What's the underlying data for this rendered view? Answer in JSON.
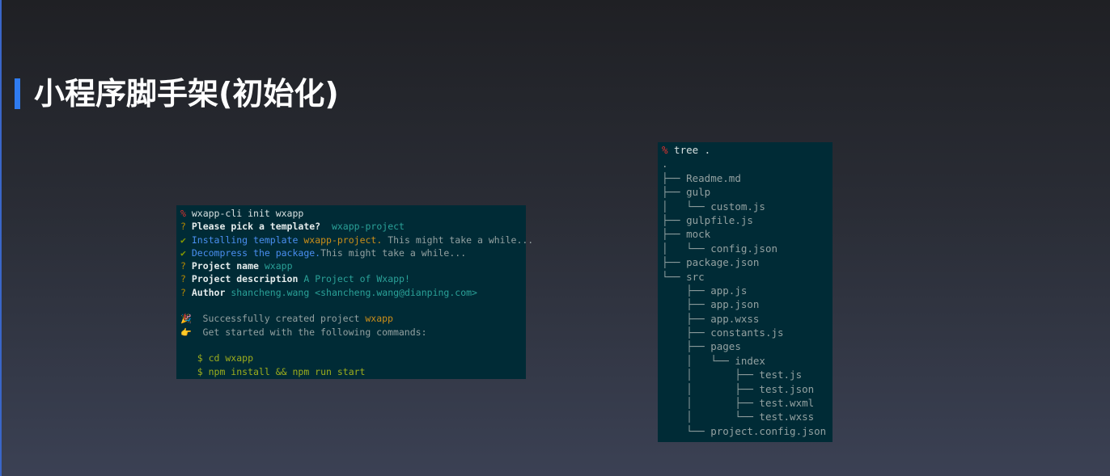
{
  "slide": {
    "title": "小程序脚手架(初始化)"
  },
  "left_terminal": {
    "prompt": "%",
    "command": " wxapp-cli init wxapp",
    "q1_mark": "?",
    "q1_label": " Please pick a template?",
    "q1_value": "  wxapp-project",
    "install_mark": "✔",
    "install_text": " Installing template",
    "install_name": " wxapp-project.",
    "install_tail": " This might take a while...",
    "decompress_mark": "✔",
    "decompress_text": " Decompress the package.",
    "decompress_tail": "This might take a while...",
    "q2_mark": "?",
    "q2_label": " Project name",
    "q2_value": " wxapp",
    "q3_mark": "?",
    "q3_label": " Project description",
    "q3_value": " A Project of Wxapp!",
    "q4_mark": "?",
    "q4_label": " Author",
    "q4_value": " shancheng.wang <shancheng.wang@dianping.com>",
    "success_icon": "🎉",
    "success_text": "  Successfully created project",
    "success_name": " wxapp",
    "start_icon": "👉",
    "start_text": "  Get started with the following commands:",
    "cmd1": "   $ cd wxapp",
    "cmd2": "   $ npm install && npm run start",
    "colors": {
      "background": "#002b36",
      "prompt": "#dc322f",
      "question": "#b58900",
      "check": "#859900",
      "value": "#2aa198",
      "highlight": "#cb8f19",
      "install": "#4a8ff0"
    }
  },
  "right_terminal": {
    "prompt": "%",
    "command": " tree .",
    "lines": [
      {
        "branch": "",
        "name": "."
      },
      {
        "branch": "├── ",
        "name": "Readme.md"
      },
      {
        "branch": "├── ",
        "name": "gulp"
      },
      {
        "branch": "│   └── ",
        "name": "custom.js"
      },
      {
        "branch": "├── ",
        "name": "gulpfile.js"
      },
      {
        "branch": "├── ",
        "name": "mock"
      },
      {
        "branch": "│   └── ",
        "name": "config.json"
      },
      {
        "branch": "├── ",
        "name": "package.json"
      },
      {
        "branch": "└── ",
        "name": "src"
      },
      {
        "branch": "    ├── ",
        "name": "app.js"
      },
      {
        "branch": "    ├── ",
        "name": "app.json"
      },
      {
        "branch": "    ├── ",
        "name": "app.wxss"
      },
      {
        "branch": "    ├── ",
        "name": "constants.js"
      },
      {
        "branch": "    ├── ",
        "name": "pages"
      },
      {
        "branch": "    │   └── ",
        "name": "index"
      },
      {
        "branch": "    │       ├── ",
        "name": "test.js"
      },
      {
        "branch": "    │       ├── ",
        "name": "test.json"
      },
      {
        "branch": "    │       ├── ",
        "name": "test.wxml"
      },
      {
        "branch": "    │       └── ",
        "name": "test.wxss"
      },
      {
        "branch": "    └── ",
        "name": "project.config.json"
      }
    ]
  },
  "accent_color": "#2f7bf0"
}
